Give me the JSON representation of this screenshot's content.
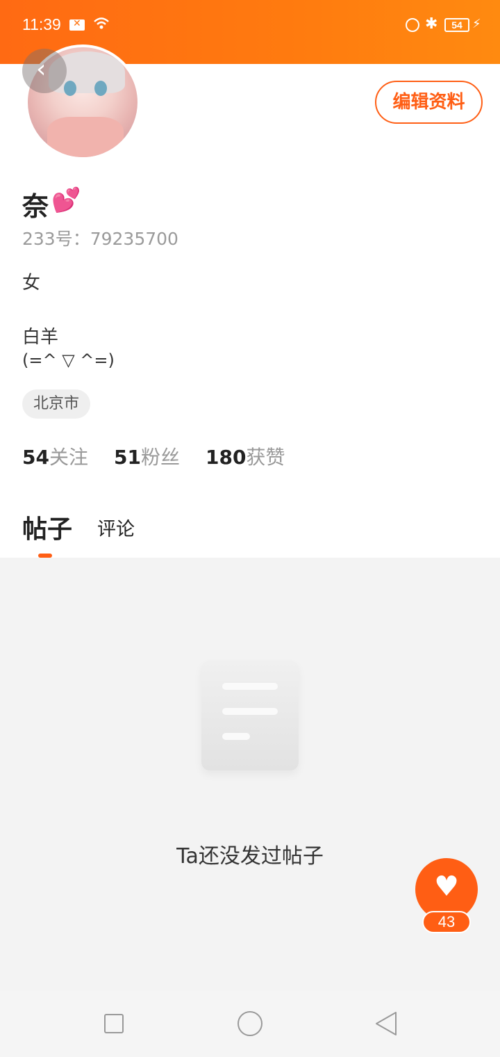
{
  "status_bar": {
    "time": "11:39",
    "battery": "54",
    "icons": [
      "mail-x-icon",
      "wifi-icon",
      "lock-icon",
      "bluetooth-icon",
      "battery-icon",
      "charging-icon"
    ]
  },
  "colors": {
    "accent": "#ff5e14",
    "status_bar": "#ff7410",
    "content_bg": "#f3f3f3"
  },
  "profile": {
    "name": "奈",
    "name_emoji": "💕",
    "id_line": "233号：79235700",
    "gender": "女",
    "bio_line1": "白羊",
    "bio_line2": "(=^ ▽ ^=)",
    "location": "北京市",
    "edit_button": "编辑资料"
  },
  "stats": [
    {
      "value": "54",
      "label": "关注"
    },
    {
      "value": "51",
      "label": "粉丝"
    },
    {
      "value": "180",
      "label": "获赞"
    }
  ],
  "tabs": [
    {
      "label": "帖子",
      "active": true
    },
    {
      "label": "评论",
      "active": false
    }
  ],
  "empty_state": {
    "message": "Ta还没发过帖子"
  },
  "fab": {
    "icon": "heart-icon",
    "count": "43"
  },
  "nav": {
    "icons": [
      "recent-apps-icon",
      "home-icon",
      "back-icon"
    ]
  }
}
